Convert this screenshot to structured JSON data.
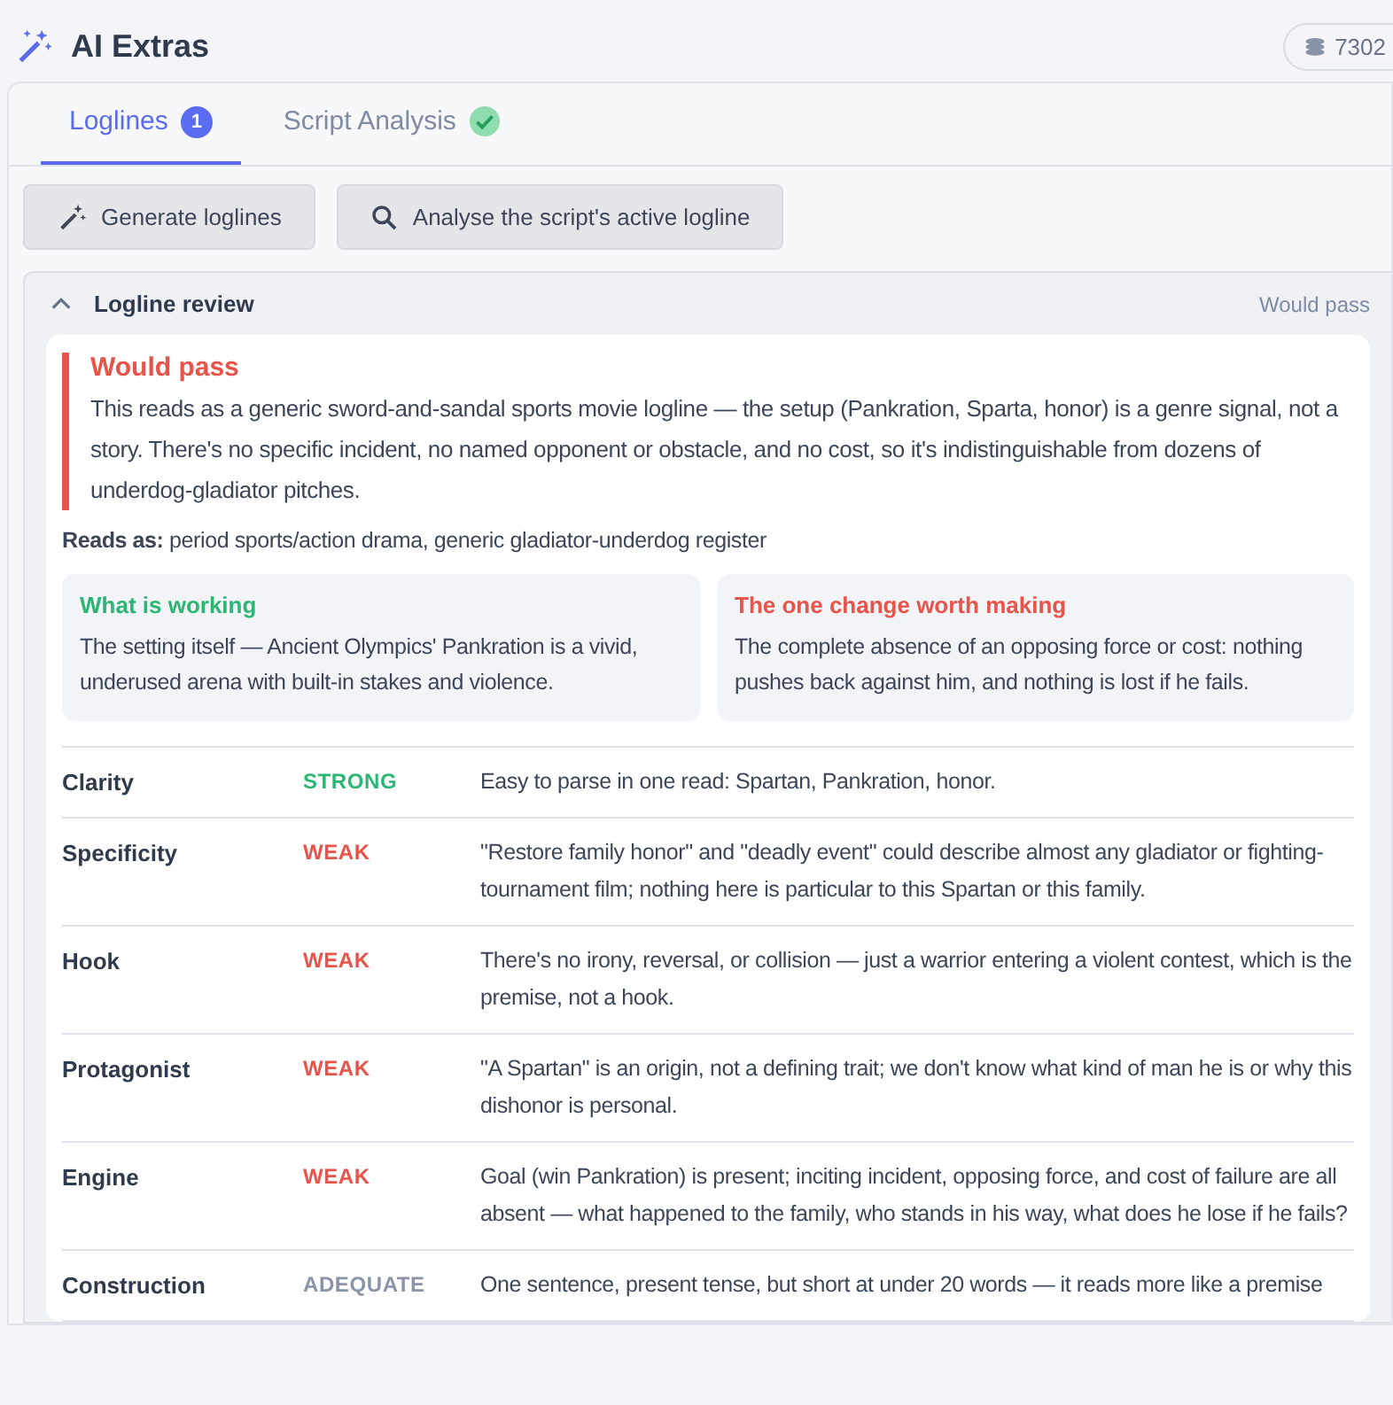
{
  "header": {
    "title": "AI Extras",
    "credits": "7302"
  },
  "tabs": [
    {
      "label": "Loglines",
      "selected": true,
      "badge": "1",
      "complete": false
    },
    {
      "label": "Script Analysis",
      "selected": false,
      "complete": true
    }
  ],
  "actions": [
    {
      "label": "Generate loglines",
      "kind": "wand"
    },
    {
      "label": "Analyse the script's active logline",
      "kind": "search"
    }
  ],
  "review": {
    "title": "Logline review",
    "expanded": true,
    "status": "Would pass",
    "verdict": {
      "title": "Would pass",
      "text": "This reads as a generic sword-and-sandal sports movie logline — the setup (Pankration, Sparta, honor) is a genre signal, not a story. There's no specific incident, no named opponent or obstacle, and no cost, so it's indistinguishable from dozens of underdog-gladiator pitches."
    },
    "reads_as": "**Reads as:** period sports/action drama, generic gladiator-underdog register",
    "cards": [
      {
        "title": "What is working",
        "kind": "good",
        "text": "The setting itself — Ancient Olympics' Pankration is a vivid, underused arena with built-in stakes and violence."
      },
      {
        "title": "The one change worth making",
        "kind": "bad",
        "text": "The complete absence of an opposing force or cost: nothing pushes back against him, and nothing is lost if he fails."
      }
    ],
    "rows": [
      {
        "name": "Clarity",
        "rating": "STRONG",
        "kind": "strong",
        "note": "Easy to parse in one read: Spartan, Pankration, honor."
      },
      {
        "name": "Specificity",
        "rating": "WEAK",
        "kind": "weak",
        "note": "\"Restore family honor\" and \"deadly event\" could describe almost any gladiator or fighting-tournament film; nothing here is particular to this Spartan or this family."
      },
      {
        "name": "Hook",
        "rating": "WEAK",
        "kind": "weak",
        "note": "There's no irony, reversal, or collision — just a warrior entering a violent contest, which is the premise, not a hook."
      },
      {
        "name": "Protagonist",
        "rating": "WEAK",
        "kind": "weak",
        "note": "\"A Spartan\" is an origin, not a defining trait; we don't know what kind of man he is or why this dishonor is personal."
      },
      {
        "name": "Engine",
        "rating": "WEAK",
        "kind": "weak",
        "note": "Goal (win Pankration) is present; inciting incident, opposing force, and cost of failure are all absent — what happened to the family, who stands in his way, what does he lose if he fails?"
      },
      {
        "name": "Construction",
        "rating": "ADEQUATE",
        "kind": "adequate",
        "note": "One sentence, present tense, but short at under 20 words — it reads more like a premise"
      }
    ]
  }
}
